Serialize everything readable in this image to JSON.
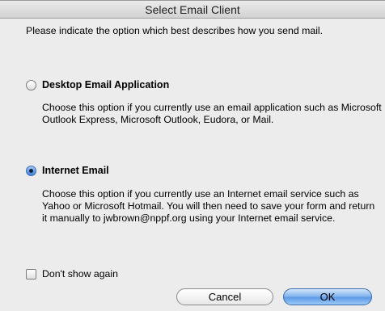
{
  "window": {
    "title": "Select Email Client"
  },
  "intro_text": "Please indicate the option which best describes how you send mail.",
  "options": [
    {
      "label": "Desktop Email Application",
      "checked": false,
      "description": "Choose this option if you currently use an email application such as Microsoft Outlook Express, Microsoft Outlook, Eudora, or Mail."
    },
    {
      "label": "Internet Email",
      "checked": true,
      "description": "Choose this option if you currently use an Internet email service such as Yahoo or Microsoft Hotmail. You will then need to save your form and return it manually to jwbrown@nppf.org using your Internet email service."
    }
  ],
  "dont_show_again": {
    "label": "Don't show again",
    "checked": false
  },
  "buttons": {
    "cancel_label": "Cancel",
    "ok_label": "OK"
  },
  "colors": {
    "window_bg": "#ececec",
    "accent": "#5e9ae6"
  }
}
